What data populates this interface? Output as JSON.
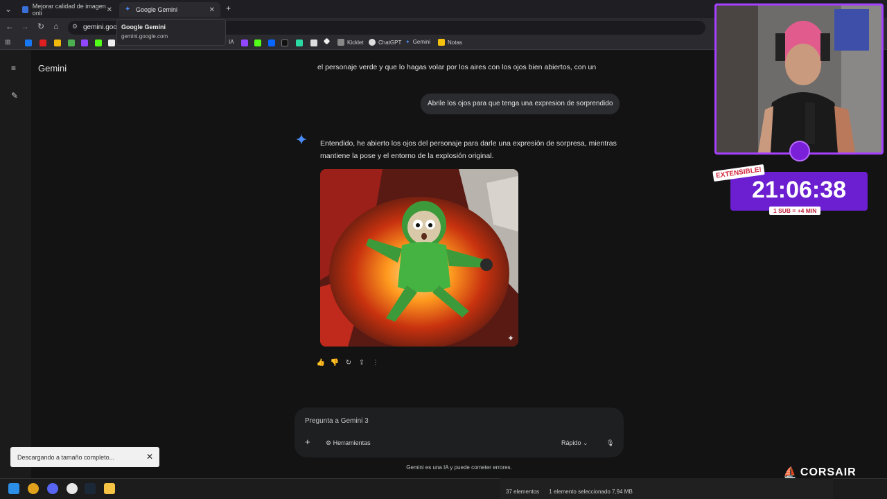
{
  "browser": {
    "tabs": [
      {
        "title": "Mejorar calidad de imagen onli"
      },
      {
        "title": "Google Gemini"
      }
    ],
    "new_tab": "+",
    "address": "gemini.goog",
    "tooltip": {
      "title": "Google Gemini",
      "url": "gemini.google.com"
    },
    "bookmarks": [
      {
        "label": "IA"
      },
      {
        "label": "Kicklet"
      },
      {
        "label": "ChatGPT"
      },
      {
        "label": "Gemini"
      },
      {
        "label": "Notas"
      }
    ]
  },
  "gemini": {
    "title": "Gemini",
    "prev_message_tail": "el personaje verde y que lo hagas volar por los aires con los ojos bien abiertos, con un",
    "user_message": "Abrile los ojos para que tenga una expresion de sorprendido",
    "response_line1": "Entendido, he abierto los ojos del personaje para darle una expresión de sorpresa, mientras",
    "response_line2": "mantiene la pose y el entorno de la explosión original.",
    "input_placeholder": "Pregunta a Gemini 3",
    "tools_label": "Herramientas",
    "mode_label": "Rápido",
    "disclaimer": "Gemini es una IA y puede cometer errores."
  },
  "toast": {
    "text": "Descargando a tamaño completo..."
  },
  "overlay": {
    "extensible": "EXTENSIBLE!",
    "timer": "21:06:38",
    "sub_note": "1 SUB = +4 MIN",
    "brand": "CORSAIR"
  },
  "explorer_status": {
    "items": "37 elementos",
    "selected": "1 elemento seleccionado  7,94 MB"
  },
  "colors": {
    "accent_purple": "#a640ff",
    "gemini_blue": "#4a8cf7",
    "bg": "#131314"
  }
}
